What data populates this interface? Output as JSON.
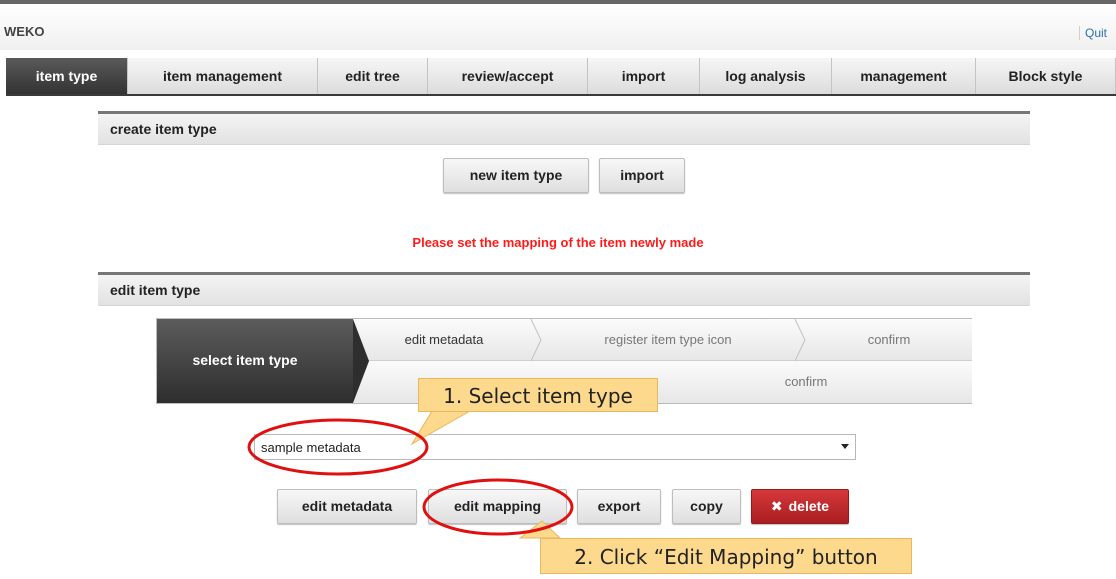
{
  "app": {
    "logo": "WEKO",
    "quit": "Quit"
  },
  "nav": {
    "tabs": [
      {
        "label": "item type",
        "active": true
      },
      {
        "label": "item management"
      },
      {
        "label": "edit tree"
      },
      {
        "label": "review/accept"
      },
      {
        "label": "import"
      },
      {
        "label": "log analysis"
      },
      {
        "label": "management"
      },
      {
        "label": "Block style"
      }
    ]
  },
  "create_section": {
    "title": "create item type",
    "new_button": "new item type",
    "import_button": "import"
  },
  "notice": "Please set the mapping of the item newly made",
  "edit_section": {
    "title": "edit item type",
    "wizard": {
      "active_step": "select item type",
      "row1": [
        "edit metadata",
        "register item type icon",
        "confirm"
      ],
      "row2": [
        "confirm"
      ]
    },
    "select_value": "sample metadata",
    "buttons": {
      "edit_metadata": "edit metadata",
      "edit_mapping": "edit mapping",
      "export": "export",
      "copy": "copy",
      "delete": "delete"
    }
  },
  "callouts": {
    "step1": "1. Select item type",
    "step2": "2. Click “Edit Mapping” button"
  },
  "colors": {
    "notice": "#ff1a1a",
    "annotation": "#e01010",
    "callout": "#fcd98d",
    "delete_button": "#c62b2d",
    "active_tab": "#333333"
  }
}
